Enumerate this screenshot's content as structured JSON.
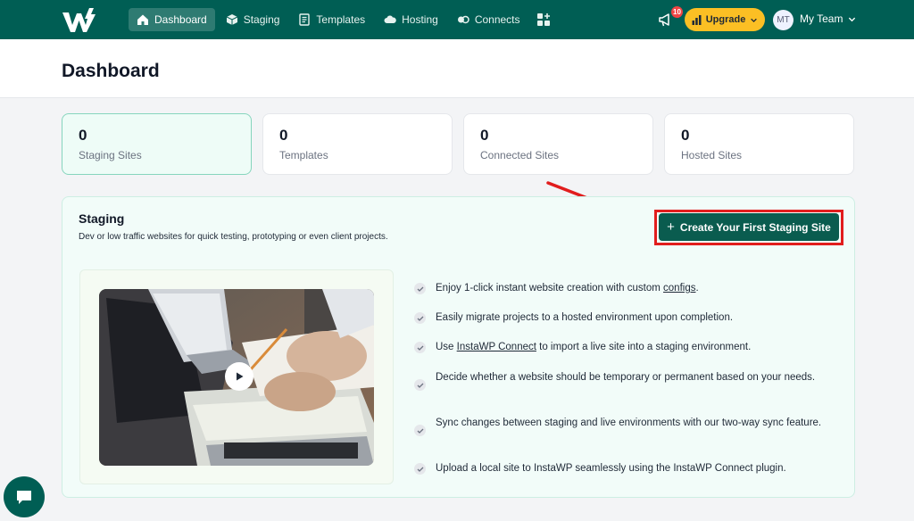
{
  "nav": {
    "items": [
      {
        "label": "Dashboard",
        "icon": "home-icon"
      },
      {
        "label": "Staging",
        "icon": "cube-icon"
      },
      {
        "label": "Templates",
        "icon": "document-icon"
      },
      {
        "label": "Hosting",
        "icon": "cloud-icon"
      },
      {
        "label": "Connects",
        "icon": "connect-icon"
      }
    ],
    "notifications_count": "10",
    "upgrade_label": "Upgrade",
    "avatar_initials": "MT",
    "team_label": "My Team"
  },
  "page": {
    "title": "Dashboard"
  },
  "stats": [
    {
      "value": "0",
      "label": "Staging Sites"
    },
    {
      "value": "0",
      "label": "Templates"
    },
    {
      "value": "0",
      "label": "Connected Sites"
    },
    {
      "value": "0",
      "label": "Hosted Sites"
    }
  ],
  "staging": {
    "title": "Staging",
    "subtitle": "Dev or low traffic websites for quick testing, prototyping or even client projects.",
    "cta_label": "Create Your First Staging Site",
    "features": {
      "f1_pre": "Enjoy 1-click instant website creation with custom ",
      "f1_link": "configs",
      "f1_post": ".",
      "f2": "Easily migrate projects to a hosted environment upon completion.",
      "f3_pre": "Use ",
      "f3_link": "InstaWP Connect",
      "f3_post": " to import a live site into a staging environment.",
      "f4": "Decide whether a website should be temporary or permanent based on your needs.",
      "f5": "Sync changes between staging and live environments with our two-way sync feature.",
      "f6": "Upload a local site to InstaWP seamlessly using the InstaWP Connect plugin."
    }
  },
  "colors": {
    "brand": "#005e54",
    "accent": "#fbbf24",
    "highlight": "#e11d1d"
  }
}
